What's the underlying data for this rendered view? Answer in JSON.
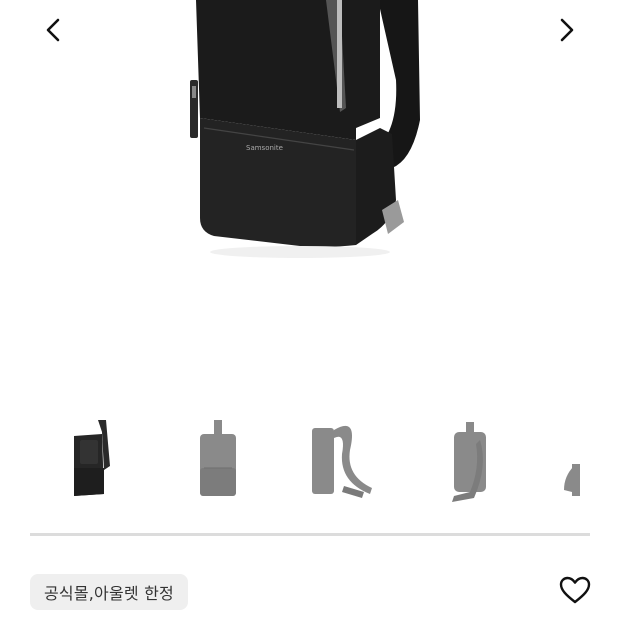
{
  "product": {
    "brand_mark": "Samsonite",
    "badge_label": "공식몰,아울렛 한정"
  },
  "gallery": {
    "prev_icon": "chevron-left-icon",
    "next_icon": "chevron-right-icon",
    "thumbnails": [
      {
        "view": "front-angle",
        "selected": true
      },
      {
        "view": "front",
        "selected": false
      },
      {
        "view": "side",
        "selected": false
      },
      {
        "view": "back",
        "selected": false
      },
      {
        "view": "side-partial",
        "selected": false
      }
    ]
  },
  "actions": {
    "like_icon": "heart-outline-icon"
  },
  "colors": {
    "bag": "#1a1a1a",
    "thumb_selected": "#2a2a2a",
    "thumb_unselected": "#8a8a8a",
    "badge_bg": "#efefef",
    "divider": "#dcdcdc"
  }
}
